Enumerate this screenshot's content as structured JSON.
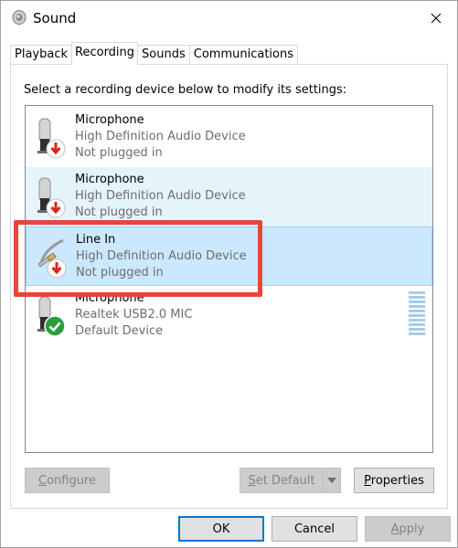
{
  "window": {
    "title": "Sound",
    "close_glyph": "✕"
  },
  "tabs": [
    {
      "label": "Playback",
      "active": false
    },
    {
      "label": "Recording",
      "active": true
    },
    {
      "label": "Sounds",
      "active": false
    },
    {
      "label": "Communications",
      "active": false
    }
  ],
  "recording": {
    "instruction": "Select a recording device below to modify its settings:",
    "devices": [
      {
        "name": "Microphone",
        "driver": "High Definition Audio Device",
        "status": "Not plugged in",
        "icon": "microphone-icon",
        "badge": "unplugged-badge",
        "selection": "none"
      },
      {
        "name": "Microphone",
        "driver": "High Definition Audio Device",
        "status": "Not plugged in",
        "icon": "microphone-icon",
        "badge": "unplugged-badge",
        "selection": "hover"
      },
      {
        "name": "Line In",
        "driver": "High Definition Audio Device",
        "status": "Not plugged in",
        "icon": "line-in-cable-icon",
        "badge": "unplugged-badge",
        "selection": "selected",
        "highlighted": true
      },
      {
        "name": "Microphone",
        "driver": "Realtek USB2.0 MIC",
        "status": "Default Device",
        "icon": "microphone-icon",
        "badge": "default-check-badge",
        "selection": "none"
      }
    ]
  },
  "actions": {
    "configure": {
      "label": "Configure",
      "mnemonic": "C",
      "enabled": false
    },
    "set_default": {
      "label": "Set Default",
      "mnemonic": "S",
      "enabled": false
    },
    "properties": {
      "label": "Properties",
      "mnemonic": "P",
      "enabled": true
    }
  },
  "dialog_buttons": {
    "ok": "OK",
    "cancel": "Cancel",
    "apply": {
      "label": "Apply",
      "mnemonic": "A",
      "enabled": false
    }
  },
  "colors": {
    "accent": "#0078d7",
    "highlight_box": "#e8453c",
    "selected_row": "#cce8ff",
    "hover_row": "#e5f3fb",
    "unplugged_badge": "#d9261c",
    "default_badge": "#2a9e3a"
  }
}
